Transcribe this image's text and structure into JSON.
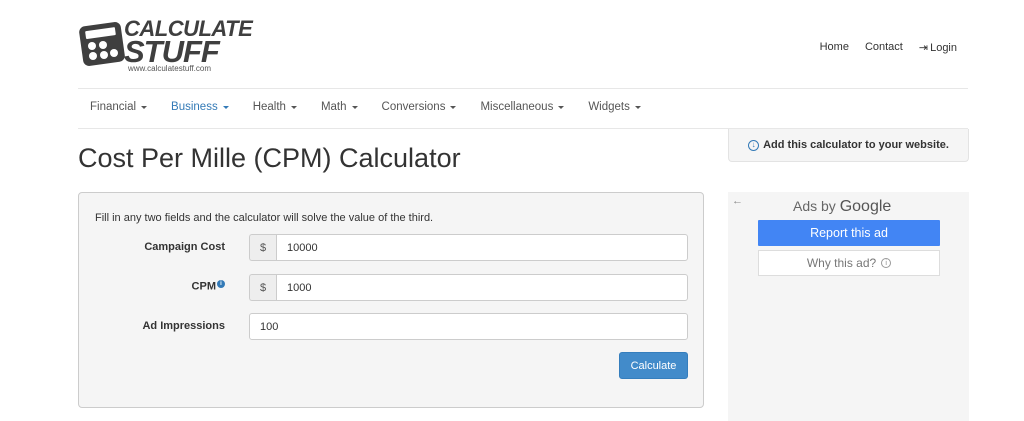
{
  "logo": {
    "line1": "CALCULATE",
    "line2": "STUFF",
    "url": "www.calculatestuff.com"
  },
  "toplinks": {
    "home": "Home",
    "contact": "Contact",
    "login": "Login"
  },
  "nav": [
    {
      "label": "Financial",
      "active": false
    },
    {
      "label": "Business",
      "active": true
    },
    {
      "label": "Health",
      "active": false
    },
    {
      "label": "Math",
      "active": false
    },
    {
      "label": "Conversions",
      "active": false
    },
    {
      "label": "Miscellaneous",
      "active": false
    },
    {
      "label": "Widgets",
      "active": false
    }
  ],
  "add_box": {
    "label": "Add this calculator to your website."
  },
  "page_title": "Cost Per Mille (CPM) Calculator",
  "calculator": {
    "instructions": "Fill in any two fields and the calculator will solve the value of the third.",
    "campaign_cost": {
      "label": "Campaign Cost",
      "addon": "$",
      "value": "10000"
    },
    "cpm": {
      "label": "CPM",
      "addon": "$",
      "value": "1000"
    },
    "ad_impressions": {
      "label": "Ad Impressions",
      "value": "100"
    },
    "calculate_label": "Calculate"
  },
  "ad": {
    "back": "←",
    "ads_by": "Ads by",
    "google": "Google",
    "report": "Report this ad",
    "why": "Why this ad?"
  },
  "colors": {
    "accent": "#337ab7",
    "button": "#428bca",
    "google_blue": "#4285f4"
  }
}
